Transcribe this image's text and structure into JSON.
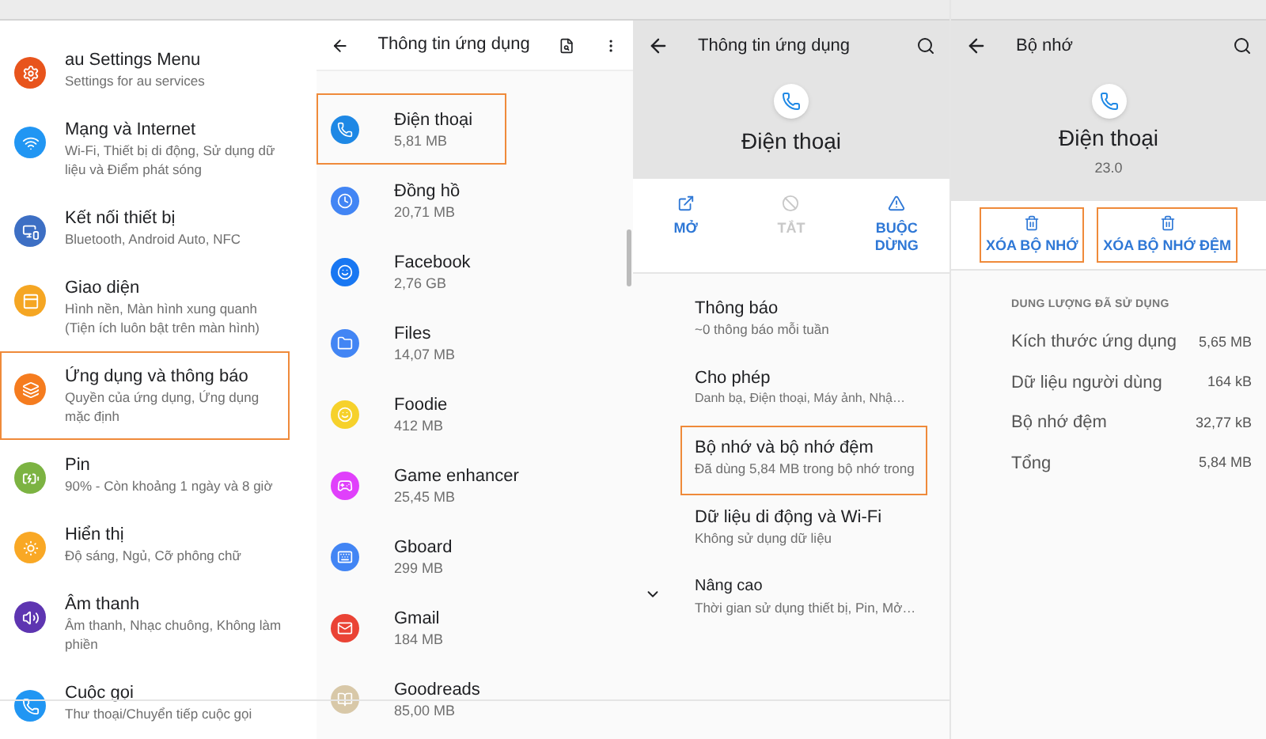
{
  "settings_panel": {
    "items": [
      {
        "title": "au Settings Menu",
        "subtitle": "Settings for au services",
        "color": "#e8541c",
        "highlighted": false
      },
      {
        "title": "Mạng và Internet",
        "subtitle": "Wi-Fi, Thiết bị di động, Sử dụng dữ liệu và Điểm phát sóng",
        "color": "#2196f3",
        "highlighted": false
      },
      {
        "title": "Kết nối thiết bị",
        "subtitle": "Bluetooth, Android Auto, NFC",
        "color": "#3d6fc4",
        "highlighted": false
      },
      {
        "title": "Giao diện",
        "subtitle": "Hình nền, Màn hình xung quanh (Tiện ích luôn bật trên màn hình)",
        "color": "#f5a623",
        "highlighted": false
      },
      {
        "title": "Ứng dụng và thông báo",
        "subtitle": "Quyền của ứng dụng, Ứng dụng mặc định",
        "color": "#f57c1f",
        "highlighted": true
      },
      {
        "title": "Pin",
        "subtitle": "90% - Còn khoảng 1 ngày và 8 giờ",
        "color": "#7cb342",
        "highlighted": false
      },
      {
        "title": "Hiển thị",
        "subtitle": "Độ sáng, Ngủ, Cỡ phông chữ",
        "color": "#f9a825",
        "highlighted": false
      },
      {
        "title": "Âm thanh",
        "subtitle": "Âm thanh, Nhạc chuông, Không làm phiền",
        "color": "#5e35b1",
        "highlighted": false
      },
      {
        "title": "Cuộc gọi",
        "subtitle": "Thư thoại/Chuyển tiếp cuộc gọi",
        "color": "#2196f3",
        "highlighted": false
      }
    ]
  },
  "app_list_panel": {
    "title": "Thông tin ứng dụng",
    "apps": [
      {
        "name": "Điện thoại",
        "size": "5,81 MB",
        "color": "#1e88e5",
        "highlighted": true
      },
      {
        "name": "Đồng hồ",
        "size": "20,71 MB",
        "color": "#4285f4",
        "highlighted": false
      },
      {
        "name": "Facebook",
        "size": "2,76 GB",
        "color": "#1877f2",
        "highlighted": false
      },
      {
        "name": "Files",
        "size": "14,07 MB",
        "color": "#4285f4",
        "highlighted": false
      },
      {
        "name": "Foodie",
        "size": "412 MB",
        "color": "#f6d12b",
        "highlighted": false
      },
      {
        "name": "Game enhancer",
        "size": "25,45 MB",
        "color": "#e040fb",
        "highlighted": false
      },
      {
        "name": "Gboard",
        "size": "299 MB",
        "color": "#4285f4",
        "highlighted": false
      },
      {
        "name": "Gmail",
        "size": "184 MB",
        "color": "#ea4335",
        "highlighted": false
      },
      {
        "name": "Goodreads",
        "size": "85,00 MB",
        "color": "#d8c8a8",
        "highlighted": false
      }
    ]
  },
  "app_info_panel": {
    "title": "Thông tin ứng dụng",
    "app_name": "Điện thoại",
    "actions": [
      {
        "label": "MỞ",
        "disabled": false
      },
      {
        "label": "TẮT",
        "disabled": true
      },
      {
        "label": "BUỘC DỪNG",
        "disabled": false
      }
    ],
    "items": [
      {
        "kind": "plain",
        "title": "Thông báo",
        "subtitle": "~0 thông báo mỗi tuần",
        "highlighted": false
      },
      {
        "kind": "plain",
        "title": "Cho phép",
        "subtitle": "Danh bạ, Điện thoại, Máy ảnh, Nhậ…",
        "highlighted": false
      },
      {
        "kind": "plain",
        "title": "Bộ nhớ và bộ nhớ đệm",
        "subtitle": "Đã dùng 5,84 MB trong bộ nhớ trong",
        "highlighted": true
      },
      {
        "kind": "plain",
        "title": "Dữ liệu di động và Wi-Fi",
        "subtitle": "Không sử dụng dữ liệu",
        "highlighted": false
      },
      {
        "kind": "expander",
        "title": "Nâng cao",
        "subtitle": "Thời gian sử dụng thiết bị, Pin, Mở…",
        "highlighted": false
      }
    ]
  },
  "storage_panel": {
    "title": "Bộ nhớ",
    "app_name": "Điện thoại",
    "version": "23.0",
    "actions": [
      {
        "label": "XÓA BỘ NHỚ",
        "highlighted": true
      },
      {
        "label": "XÓA BỘ NHỚ ĐỆM",
        "highlighted": true
      }
    ],
    "section": "DUNG LƯỢNG ĐÃ SỬ DỤNG",
    "rows": [
      {
        "label": "Kích thước ứng dụng",
        "value": "5,65 MB"
      },
      {
        "label": "Dữ liệu người dùng",
        "value": "164 kB"
      },
      {
        "label": "Bộ nhớ đệm",
        "value": "32,77 kB"
      },
      {
        "label": "Tổng",
        "value": "5,84 MB"
      }
    ]
  }
}
